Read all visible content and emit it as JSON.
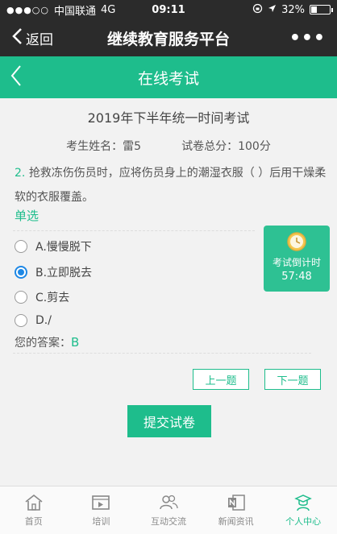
{
  "status": {
    "dots": "●●●○○",
    "carrier": "中国联通",
    "network": "4G",
    "time": "09:11",
    "battery": "32%",
    "battery_level": 0.32
  },
  "nav": {
    "back_label": "返回",
    "title": "继续教育服务平台",
    "more": "•••"
  },
  "header": {
    "title": "在线考试"
  },
  "exam": {
    "title": "2019年下半年统一时间考试",
    "name_label": "考生姓名：",
    "name_value": "雷5",
    "score_label": "试卷总分：",
    "score_value": "100分"
  },
  "question": {
    "number": "2.",
    "text": "抢救冻伤伤员时，应将伤员身上的潮湿衣服（ ）后用干燥柔软的衣服覆盖。",
    "type": "单选",
    "options": [
      {
        "label": "A.慢慢脱下",
        "checked": false
      },
      {
        "label": "B.立即脱去",
        "checked": true
      },
      {
        "label": "C.剪去",
        "checked": false
      },
      {
        "label": "D./",
        "checked": false
      }
    ],
    "answer_label": "您的答案：",
    "answer_value": "B"
  },
  "timer": {
    "label": "考试倒计时",
    "time": "57:48"
  },
  "buttons": {
    "prev": "上一题",
    "next": "下一题",
    "submit": "提交试卷"
  },
  "tabs": [
    {
      "label": "首页",
      "icon": "home-icon",
      "active": false
    },
    {
      "label": "培训",
      "icon": "video-icon",
      "active": false
    },
    {
      "label": "互动交流",
      "icon": "people-icon",
      "active": false
    },
    {
      "label": "新闻资讯",
      "icon": "news-icon",
      "active": false
    },
    {
      "label": "个人中心",
      "icon": "user-icon",
      "active": true
    }
  ],
  "colors": {
    "accent": "#1ebd8c",
    "radio": "#1e88e5",
    "dark": "#2b2b2b"
  }
}
